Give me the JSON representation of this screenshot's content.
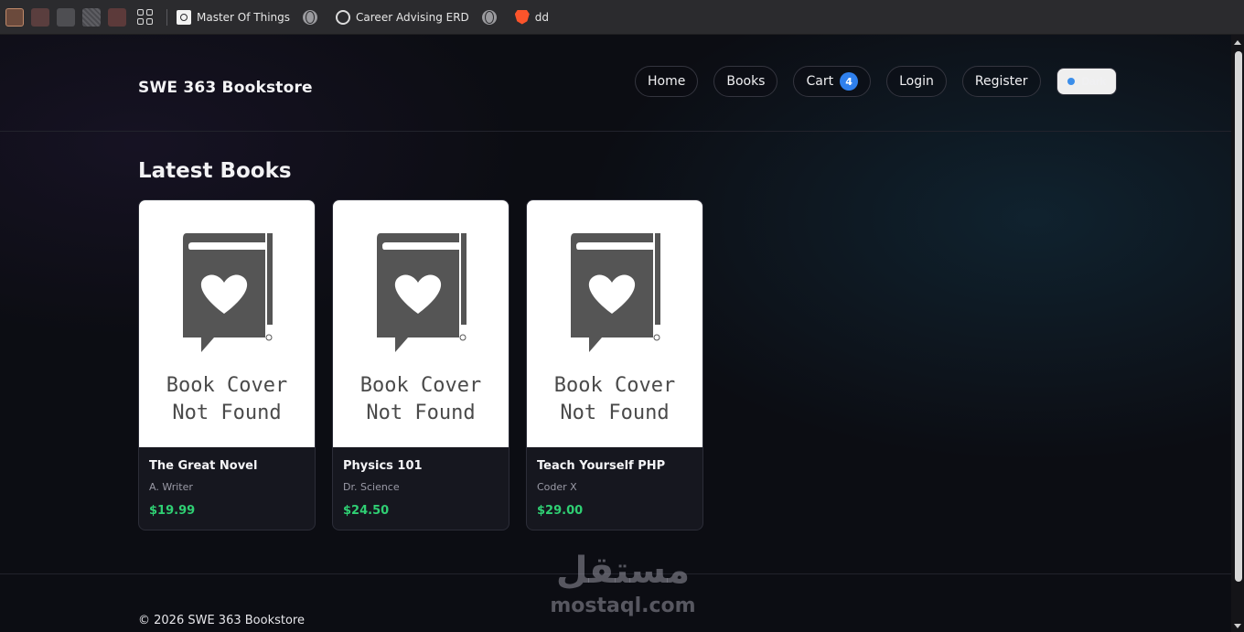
{
  "browser": {
    "bookmarks": [
      {
        "label": "Master Of Things",
        "icon": "master-of-things-favicon"
      },
      {
        "label": "",
        "icon": "globe-icon"
      },
      {
        "label": "Career Advising ERD",
        "icon": "chatgpt-favicon"
      },
      {
        "label": "",
        "icon": "globe-icon"
      },
      {
        "label": "dd",
        "icon": "brave-favicon"
      }
    ]
  },
  "header": {
    "brand": "SWE 363 Bookstore",
    "nav": {
      "home": "Home",
      "books": "Books",
      "cart": "Cart",
      "cart_count": "4",
      "login": "Login",
      "register": "Register"
    },
    "theme_toggle": "Dark"
  },
  "main": {
    "section_title": "Latest Books",
    "cover_placeholder_line1": "Book Cover",
    "cover_placeholder_line2": "Not Found",
    "books": [
      {
        "title": "The Great Novel",
        "author": "A. Writer",
        "price": "$19.99"
      },
      {
        "title": "Physics 101",
        "author": "Dr. Science",
        "price": "$24.50"
      },
      {
        "title": "Teach Yourself PHP",
        "author": "Coder X",
        "price": "$29.00"
      }
    ]
  },
  "footer": {
    "copyright": "© 2026 SWE 363 Bookstore"
  },
  "watermark": {
    "arabic": "مستقل",
    "latin": "mostaql.com"
  },
  "colors": {
    "accent": "#2f80ed",
    "price": "#2fcf73",
    "background": "#0c0d13"
  }
}
